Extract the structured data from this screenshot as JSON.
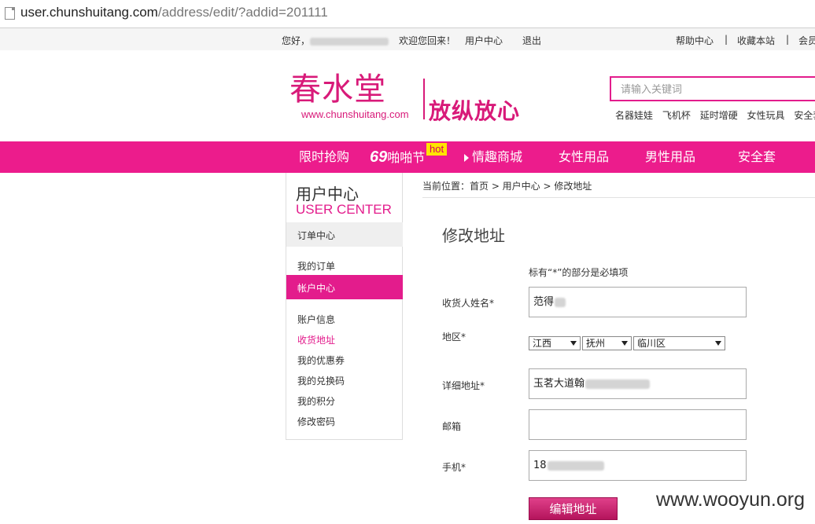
{
  "browser": {
    "url_host": "user.chunshuitang.com",
    "url_path": "/address/edit/?addid=201111"
  },
  "topbar": {
    "greeting": "您好，",
    "welcome": "欢迎您回来！",
    "user_center": "用户中心",
    "logout": "退出",
    "help_center": "帮助中心",
    "separator": "|",
    "bookmark": "收藏本站",
    "member": "会员"
  },
  "header": {
    "logo_cn": "春水堂",
    "logo_url": "www.chunshuitang.com",
    "slogan": "放纵放心",
    "search_placeholder": "请输入关键词",
    "hot_words": [
      "名器娃娃",
      "飞机杯",
      "延时增硬",
      "女性玩具",
      "安全套"
    ]
  },
  "nav": {
    "items": [
      "限时抢购",
      "啪啪节",
      "情趣商城",
      "女性用品",
      "男性用品",
      "安全套"
    ],
    "badge_69": "69",
    "hot_badge": "hot"
  },
  "sidebar": {
    "title": "用户中心",
    "title_en": "USER CENTER",
    "order_center": "订单中心",
    "my_orders": "我的订单",
    "account_center": "帐户中心",
    "links": [
      "账户信息",
      "收货地址",
      "我的优惠券",
      "我的兑换码",
      "我的积分",
      "修改密码"
    ],
    "active_color": "#e31c8c"
  },
  "breadcrumb": {
    "text": "当前位置：首页 > 用户中心 > 修改地址"
  },
  "form": {
    "title": "修改地址",
    "required_note": "标有“*”的部分是必填项",
    "name_label": "收货人姓名*",
    "name_value": "范得",
    "region_label": "地区*",
    "province": "江西",
    "city": "抚州",
    "district": "临川区",
    "address_label": "详细地址*",
    "address_value": "玉茗大道翰",
    "postcode_label": "邮箱",
    "postcode_value": "",
    "phone_label": "手机*",
    "phone_value": "18",
    "submit_label": "编辑地址"
  },
  "watermark": "www.wooyun.org",
  "colors": {
    "brand_pink": "#ec1c8c",
    "hot_yellow": "#ffe400"
  }
}
